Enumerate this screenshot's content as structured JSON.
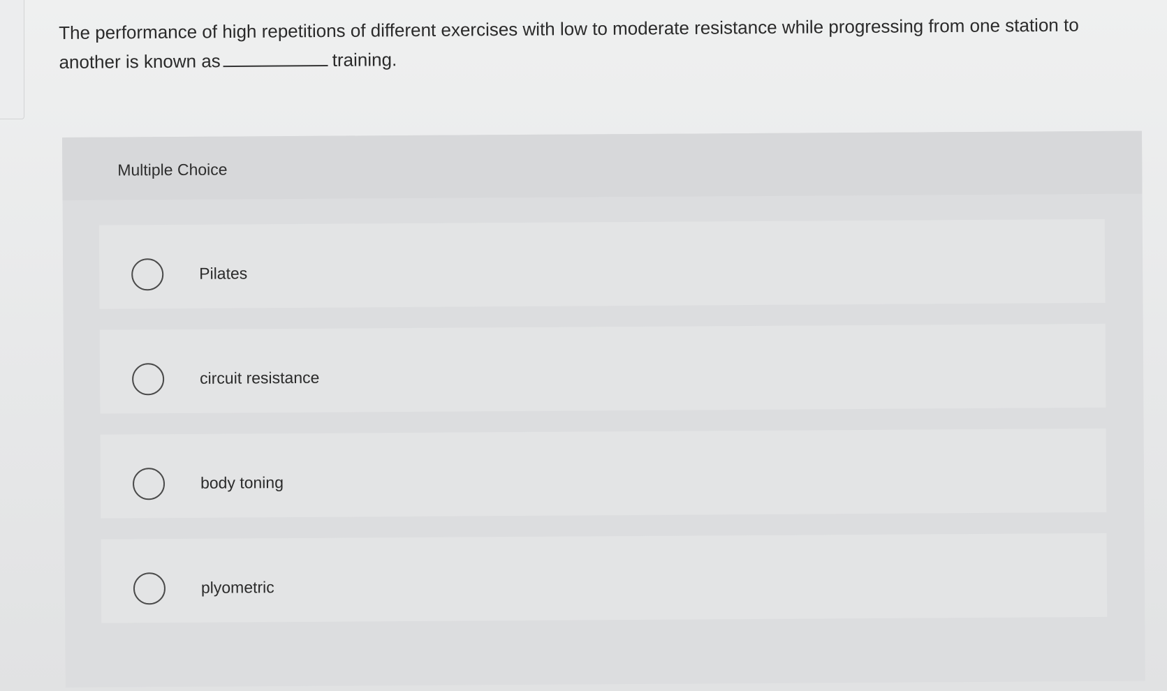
{
  "question": {
    "text_before_blank": "The performance of high repetitions of different exercises with low to moderate resistance while progressing from one station to another is known as",
    "text_after_blank": "training."
  },
  "multiple_choice": {
    "title": "Multiple Choice",
    "options": [
      {
        "label": "Pilates",
        "selected": false
      },
      {
        "label": "circuit resistance",
        "selected": false
      },
      {
        "label": "body toning",
        "selected": false
      },
      {
        "label": "plyometric",
        "selected": false
      }
    ]
  }
}
